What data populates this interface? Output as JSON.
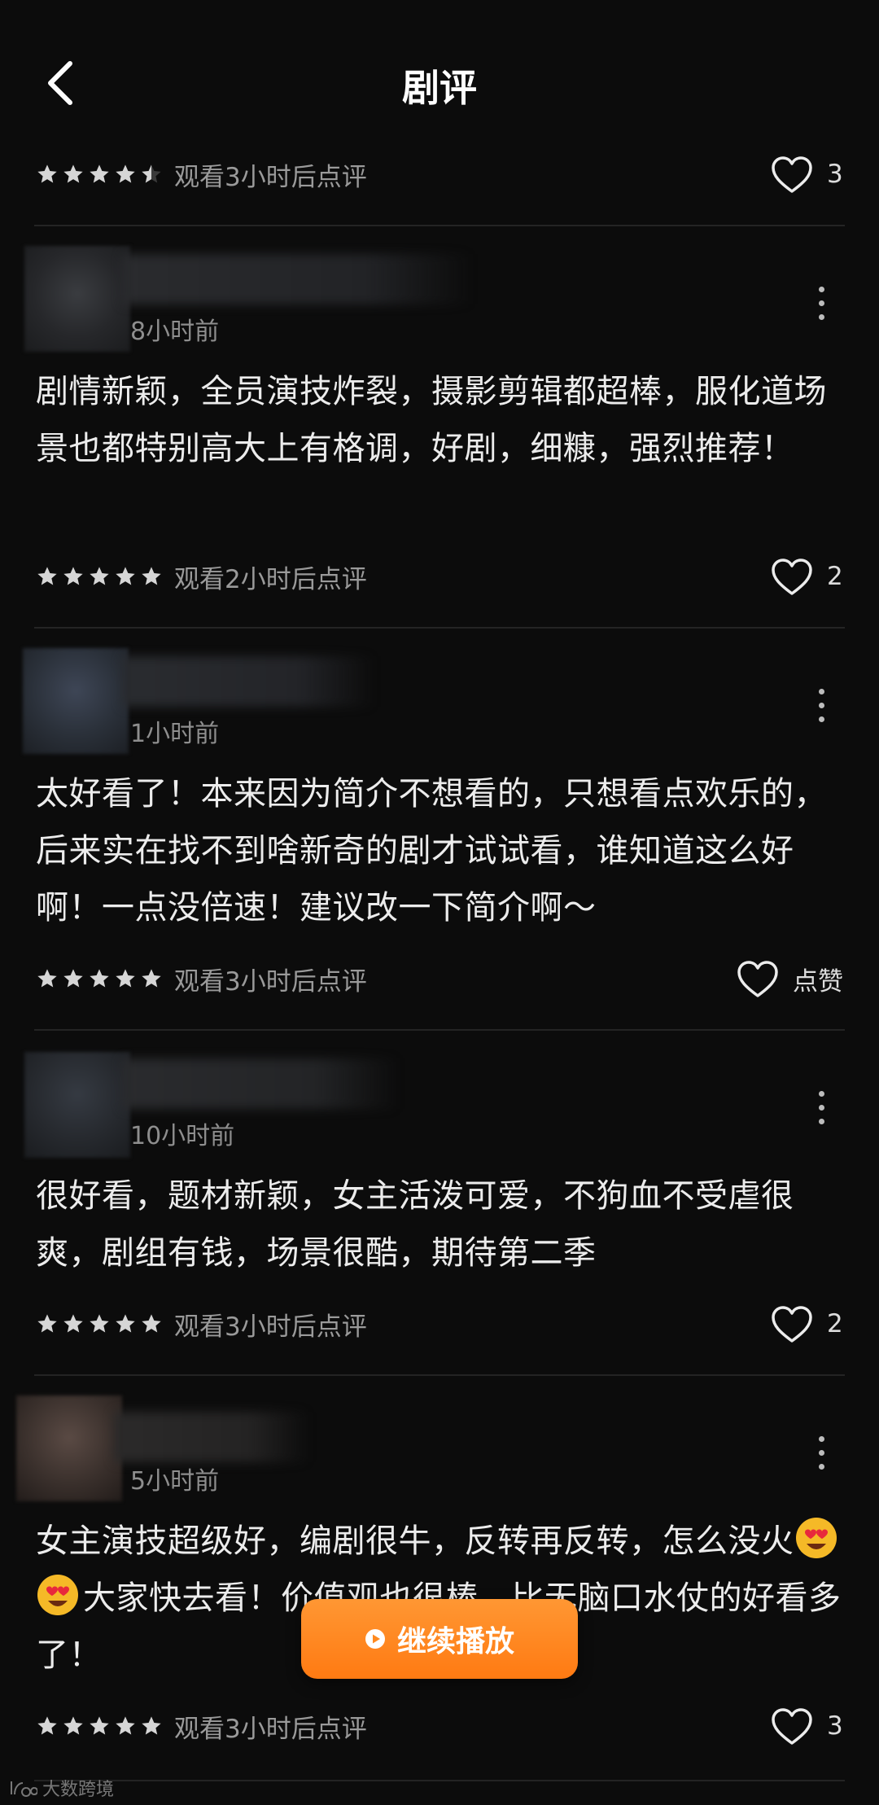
{
  "header": {
    "title": "剧评",
    "back_icon": "chevron-left-icon"
  },
  "colors": {
    "background": "#0c0c0c",
    "accent": "#ff8a1f",
    "star": "#d6d6d6"
  },
  "top_review": {
    "rating": 4.5,
    "watch_note": "观看3小时后点评",
    "likes": "3"
  },
  "reviews": [
    {
      "time": "8小时前",
      "text": "剧情新颖，全员演技炸裂，摄影剪辑都超棒，服化道场景也都特别高大上有格调，好剧，细糠，强烈推荐！",
      "rating": 5,
      "watch_note": "观看2小时后点评",
      "likes": "2"
    },
    {
      "time": "1小时前",
      "text": "太好看了！本来因为简介不想看的，只想看点欢乐的，后来实在找不到啥新奇的剧才试试看，谁知道这么好啊！一点没倍速！建议改一下简介啊～",
      "rating": 5,
      "watch_note": "观看3小时后点评",
      "likes": "点赞"
    },
    {
      "time": "10小时前",
      "text": "很好看，题材新颖，女主活泼可爱，不狗血不受虐很爽，剧组有钱，场景很酷，期待第二季",
      "rating": 5,
      "watch_note": "观看3小时后点评",
      "likes": "2"
    },
    {
      "time": "5小时前",
      "text_before": "女主演技超级好，编剧很牛，反转再反转，怎么没火",
      "text_after": "大家快去看！价值观也很棒，比无脑口水仗的好看多了！",
      "rating": 5,
      "watch_note": "观看3小时后点评",
      "likes": "3"
    }
  ],
  "continue_button": {
    "label": "继续播放",
    "icon": "play-icon"
  },
  "watermark": {
    "text": "大数跨境"
  }
}
